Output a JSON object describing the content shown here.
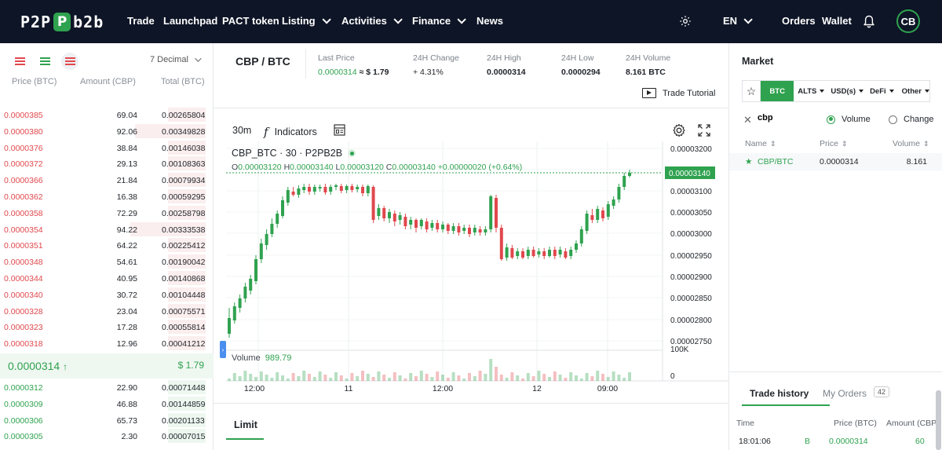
{
  "nav": {
    "logo_left": "P2P",
    "logo_box": "P",
    "logo_right": "b2b",
    "items": [
      {
        "label": "Trade"
      },
      {
        "label": "Launchpad"
      },
      {
        "label": "PACT token"
      },
      {
        "label": "Listing"
      },
      {
        "label": "Activities"
      },
      {
        "label": "Finance"
      },
      {
        "label": "News"
      }
    ],
    "language": "EN",
    "orders": "Orders",
    "wallet": "Wallet",
    "avatar": "CB"
  },
  "orderbook": {
    "decimal": "7 Decimal",
    "headers": {
      "price": "Price (BTC)",
      "amount": "Amount (CBP)",
      "total": "Total (BTC)"
    },
    "asks": [
      {
        "price": "0.0000385",
        "amount": "69.04",
        "total": "0.00265804",
        "depth": 0.3
      },
      {
        "price": "0.0000380",
        "amount": "92.06",
        "total": "0.00349828",
        "depth": 0.56
      },
      {
        "price": "0.0000376",
        "amount": "38.84",
        "total": "0.00146038",
        "depth": 0.3
      },
      {
        "price": "0.0000372",
        "amount": "29.13",
        "total": "0.00108363",
        "depth": 0.3
      },
      {
        "price": "0.0000366",
        "amount": "21.84",
        "total": "0.00079934",
        "depth": 0.3
      },
      {
        "price": "0.0000362",
        "amount": "16.38",
        "total": "0.00059295",
        "depth": 0.3
      },
      {
        "price": "0.0000358",
        "amount": "72.29",
        "total": "0.00258798",
        "depth": 0.3
      },
      {
        "price": "0.0000354",
        "amount": "94.22",
        "total": "0.00333538",
        "depth": 0.6
      },
      {
        "price": "0.0000351",
        "amount": "64.22",
        "total": "0.00225412",
        "depth": 0.3
      },
      {
        "price": "0.0000348",
        "amount": "54.61",
        "total": "0.00190042",
        "depth": 0.3
      },
      {
        "price": "0.0000344",
        "amount": "40.95",
        "total": "0.00140868",
        "depth": 0.3
      },
      {
        "price": "0.0000340",
        "amount": "30.72",
        "total": "0.00104448",
        "depth": 0.3
      },
      {
        "price": "0.0000328",
        "amount": "23.04",
        "total": "0.00075571",
        "depth": 0.3
      },
      {
        "price": "0.0000323",
        "amount": "17.28",
        "total": "0.00055814",
        "depth": 0.3
      },
      {
        "price": "0.0000318",
        "amount": "12.96",
        "total": "0.00041212",
        "depth": 0.3
      }
    ],
    "last_price": "0.0000314",
    "last_usd": "$ 1.79",
    "bids": [
      {
        "price": "0.0000312",
        "amount": "22.90",
        "total": "0.00071448",
        "depth": 0.3
      },
      {
        "price": "0.0000309",
        "amount": "46.88",
        "total": "0.00144859",
        "depth": 0.3
      },
      {
        "price": "0.0000306",
        "amount": "65.73",
        "total": "0.00201133",
        "depth": 0.3
      },
      {
        "price": "0.0000305",
        "amount": "2.30",
        "total": "0.00007015",
        "depth": 0.3
      }
    ]
  },
  "ticker": {
    "pair": "CBP / BTC",
    "last_price_label": "Last Price",
    "last_price": "0.0000314",
    "last_price_usd": "≈ $ 1.79",
    "change_label": "24H Change",
    "change": "+ 4.31%",
    "high_label": "24H High",
    "high": "0.0000314",
    "low_label": "24H Low",
    "low": "0.0000294",
    "volume_label": "24H Volume",
    "volume": "8.161 BTC",
    "tutorial": "Trade Tutorial"
  },
  "chart": {
    "interval": "30m",
    "indicators": "Indicators",
    "symbol": "CBP_BTC · 30 · P2PB2B",
    "ohlc": {
      "o": "0.00003120",
      "h": "0.00003140",
      "l": "0.00003120",
      "c": "0.00003140",
      "chg": "+0.00000020 (+0.64%)"
    },
    "volume_label": "Volume",
    "volume_value": "989.79",
    "price_axis": [
      "0.00003200",
      "0.00003100",
      "0.00003050",
      "0.00003000",
      "0.00002950",
      "0.00002900",
      "0.00002850",
      "0.00002800",
      "0.00002750"
    ],
    "current_price_tag": "0.00003140",
    "volume_axis": [
      "100K",
      "0"
    ],
    "time_axis": [
      "12:00",
      "11",
      "12:00",
      "12",
      "09:00"
    ],
    "up_color": "#2fa24f",
    "down_color": "#e0484d"
  },
  "order_form": {
    "tab": "Limit"
  },
  "market": {
    "title": "Market",
    "tabs": {
      "btc": "BTC",
      "alts": "ALTS",
      "usd": "USD(s)",
      "defi": "DeFi",
      "other": "Other"
    },
    "search_value": "cbp",
    "radio_volume": "Volume",
    "radio_change": "Change",
    "cols": {
      "name": "Name",
      "price": "Price",
      "volume": "Volume"
    },
    "row": {
      "name": "CBP/BTC",
      "price": "0.0000314",
      "volume": "8.161"
    }
  },
  "trade_history": {
    "tab_history": "Trade history",
    "tab_orders": "My Orders",
    "orders_count": "42",
    "cols": {
      "time": "Time",
      "price": "Price (BTC)",
      "amount": "Amount (CBP)"
    },
    "row": {
      "time": "18:01:06",
      "side": "B",
      "price": "0.0000314",
      "amount": "60"
    }
  }
}
